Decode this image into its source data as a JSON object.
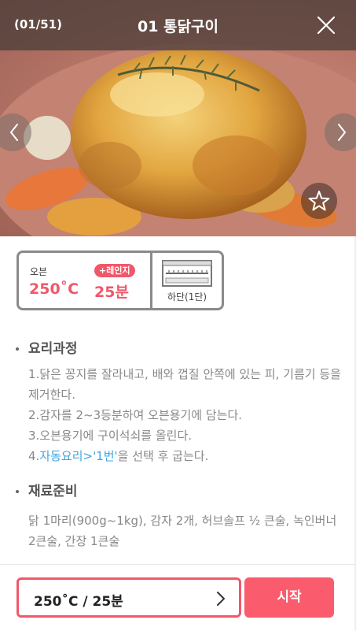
{
  "header": {
    "counter": "(01/51)",
    "title": "01 통닭구이"
  },
  "icons": {
    "close": "close-icon",
    "prev": "chevron-left-icon",
    "next": "chevron-right-icon",
    "favorite": "star-icon",
    "rack": "oven-rack-icon"
  },
  "settings": {
    "mode_label": "오븐",
    "temperature": "250˚C",
    "range_badge": "+레인지",
    "time": "25분",
    "rack_label": "하단(1단)"
  },
  "process": {
    "heading": "요리과정",
    "steps": [
      {
        "text": "1.닭은 꽁지를 잘라내고, 배와 껍질 안쪽에 있는 피, 기름기 등을 제거한다."
      },
      {
        "text": "2.감자를 2~3등분하여 오븐용기에 담는다."
      },
      {
        "text": "3.오븐용기에 구이석쇠를 올린다."
      },
      {
        "prefix": "4.",
        "highlight": "자동요리>'1번'",
        "suffix": "을 선택 후 굽는다."
      }
    ]
  },
  "ingredients": {
    "heading": "재료준비",
    "text": "닭 1마리(900g~1kg), 감자 2개, 허브솔프 ½ 큰술, 녹인버너 2큰술, 간장 1큰술"
  },
  "footer": {
    "preset": "250˚C / 25분",
    "start": "시작"
  },
  "colors": {
    "accent": "#f0586a",
    "start_button": "#fa5b6d",
    "link": "#3ea4e0",
    "card_border": "#8a8a8a"
  }
}
